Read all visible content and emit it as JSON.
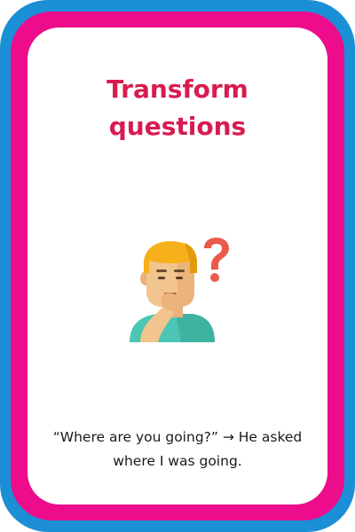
{
  "card": {
    "title_line1": "Transform",
    "title_line2": "questions",
    "caption": "“Where are you going?” → He asked where I was going.",
    "illustration_icon": "thinking-person-question-icon",
    "colors": {
      "outer_border": "#1a8fd6",
      "middle_border": "#ec0c8c",
      "title": "#d81b4e",
      "question_mark": "#ea5a4a",
      "shirt": "#4cc6b4",
      "hair": "#f6b01a",
      "skin": "#f2c58e"
    }
  }
}
